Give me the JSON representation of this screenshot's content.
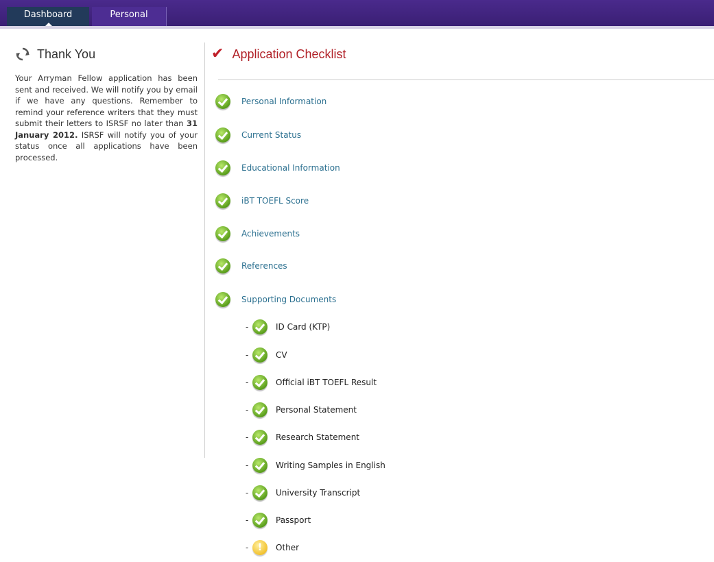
{
  "nav": {
    "tabs": [
      {
        "label": "Dashboard",
        "active": true
      },
      {
        "label": "Personal",
        "active": false
      }
    ]
  },
  "thank_you": {
    "icon": "refresh-icon",
    "title": "Thank You",
    "body_part1": "Your Arryman Fellow application has been sent and received. We will notify you by email if we have any questions. Remember to remind your reference writers that they must submit their letters to ISRSF no later than ",
    "deadline": "31 January 2012.",
    "body_part2": " ISRSF will notify you of your status once all applications have been processed."
  },
  "checklist": {
    "icon": "checkmark-icon",
    "title": "Application Checklist",
    "accent_color": "#b01e25",
    "items": [
      {
        "label": "Personal Information",
        "status": "complete"
      },
      {
        "label": "Current Status",
        "status": "complete"
      },
      {
        "label": "Educational Information",
        "status": "complete"
      },
      {
        "label": "iBT TOEFL Score",
        "status": "complete"
      },
      {
        "label": "Achievements",
        "status": "complete"
      },
      {
        "label": "References",
        "status": "complete"
      },
      {
        "label": "Supporting Documents",
        "status": "complete"
      }
    ],
    "documents": [
      {
        "label": "ID Card (KTP)",
        "status": "complete"
      },
      {
        "label": "CV",
        "status": "complete"
      },
      {
        "label": "Official iBT TOEFL Result",
        "status": "complete"
      },
      {
        "label": "Personal Statement",
        "status": "complete"
      },
      {
        "label": "Research Statement",
        "status": "complete"
      },
      {
        "label": "Writing Samples in English",
        "status": "complete"
      },
      {
        "label": "University Transcript",
        "status": "complete"
      },
      {
        "label": "Passport",
        "status": "complete"
      },
      {
        "label": "Other",
        "status": "warning"
      }
    ],
    "dash": "-"
  }
}
